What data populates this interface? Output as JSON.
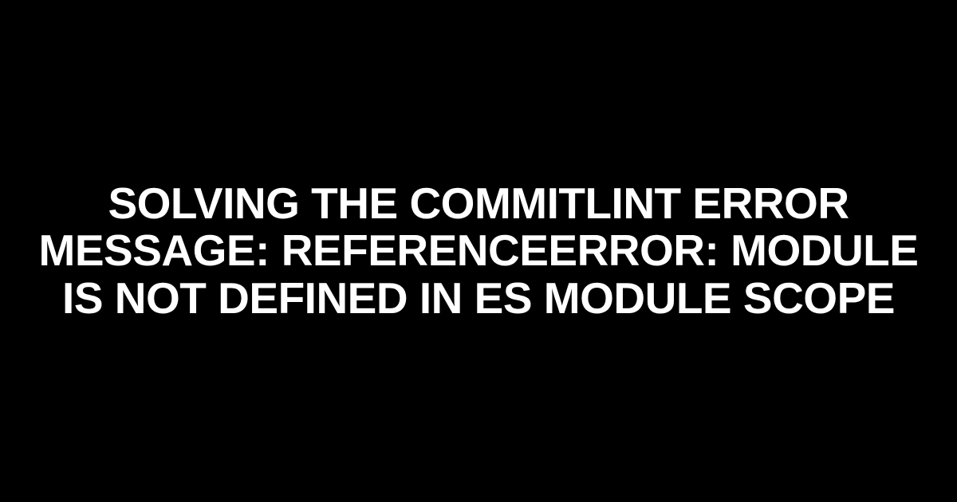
{
  "title": "SOLVING THE COMMITLINT ERROR MESSAGE: REFERENCEERROR: MODULE IS NOT DEFINED IN ES MODULE SCOPE"
}
